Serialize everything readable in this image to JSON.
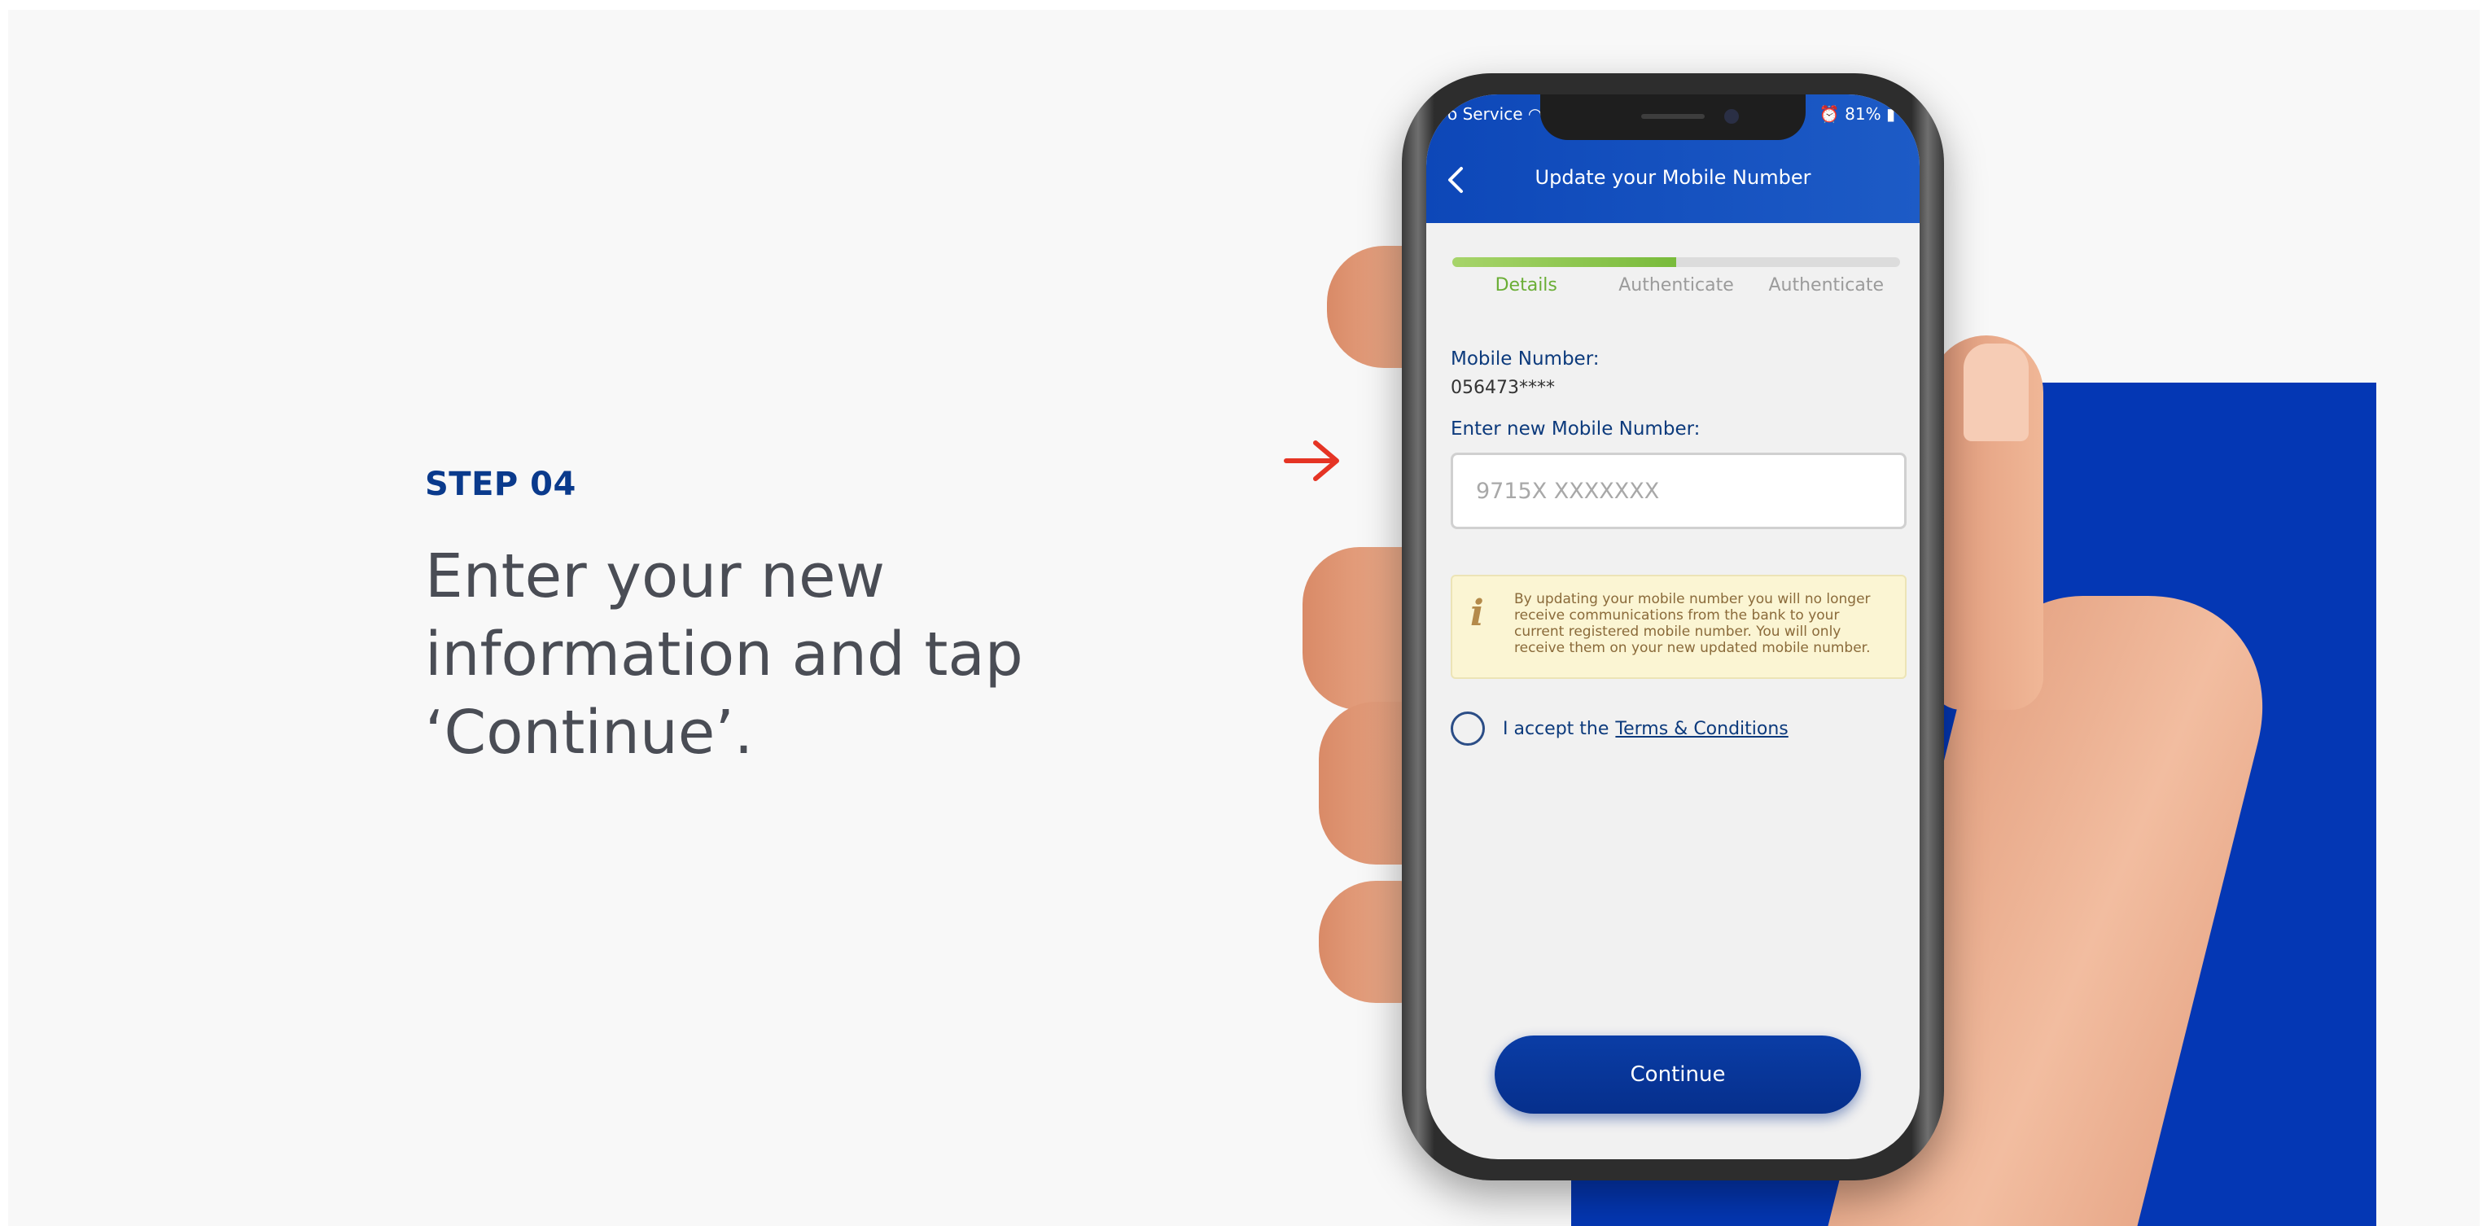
{
  "guide": {
    "step_label": "STEP 04",
    "instruction": "Enter your new information and tap ‘Continue’."
  },
  "phone": {
    "status_bar": {
      "carrier": "o Service",
      "battery": "81%"
    },
    "header": {
      "title": "Update your Mobile Number"
    },
    "progress": {
      "fraction": 0.5,
      "steps": [
        "Details",
        "Authenticate",
        "Authenticate"
      ],
      "active_index": 0
    },
    "current_number": {
      "label": "Mobile Number:",
      "value": "056473****"
    },
    "new_number": {
      "label": "Enter new Mobile Number:",
      "placeholder": "9715X XXXXXXX",
      "value": ""
    },
    "notice": {
      "icon": "info-icon",
      "text": "By updating your mobile number you will no longer receive communications from the bank to your current registered mobile number. You will only receive them on your new updated mobile number."
    },
    "terms": {
      "prefix": "I accept the",
      "link": "Terms & Conditions"
    },
    "continue_label": "Continue"
  },
  "colors": {
    "brand_blue": "#0437b4",
    "header_blue": "#0d47b8",
    "progress_green": "#79bb3b",
    "arrow_red": "#e53424",
    "notice_bg": "#fbf5d3"
  }
}
